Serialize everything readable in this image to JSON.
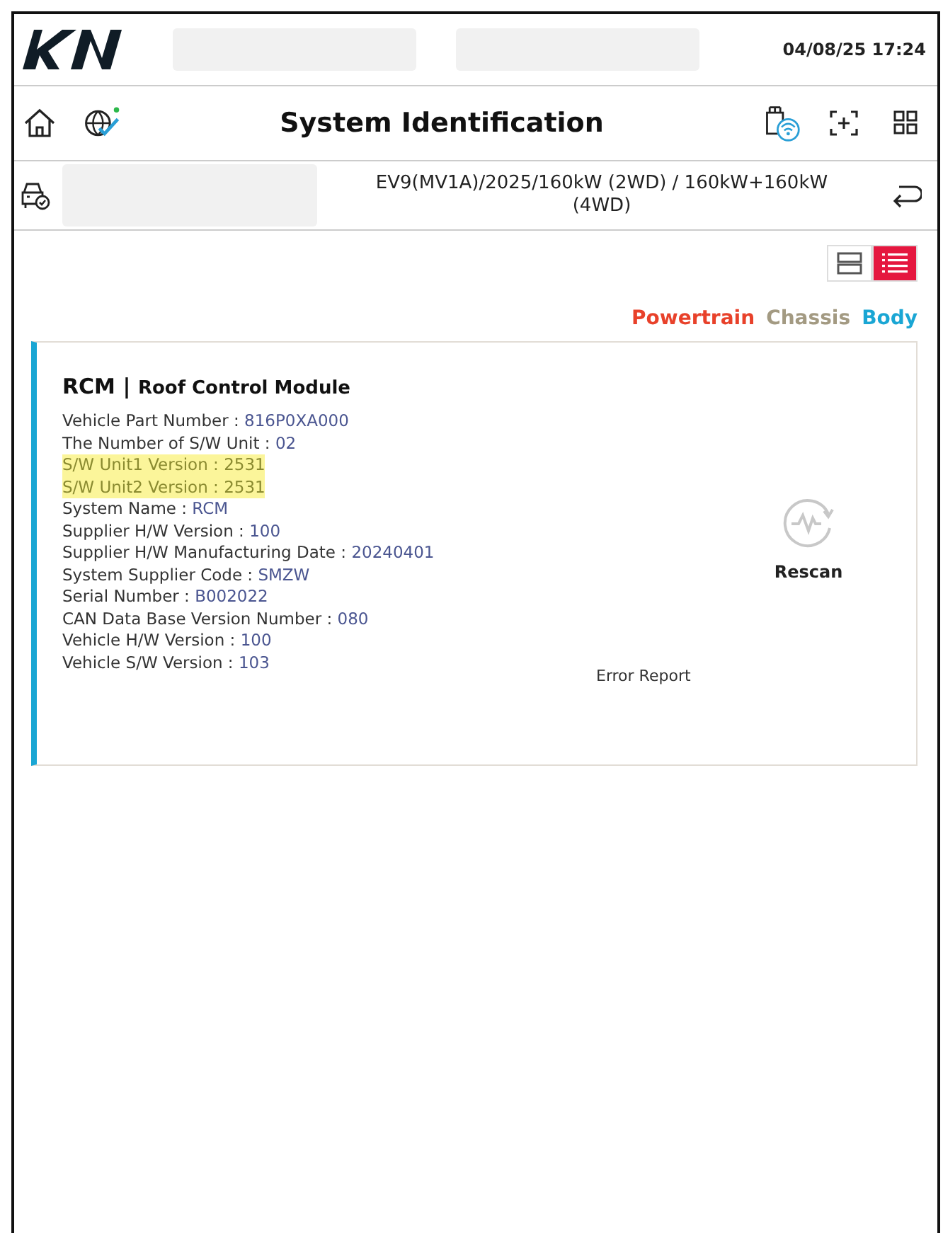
{
  "header": {
    "datetime": "04/08/25 17:24"
  },
  "nav": {
    "title": "System Identification"
  },
  "vehicle": {
    "description": "EV9(MV1A)/2025/160kW (2WD) / 160kW+160kW (4WD)"
  },
  "view_toggles": [
    {
      "kind": "cards",
      "selected": false
    },
    {
      "kind": "list",
      "selected": true
    }
  ],
  "categories": [
    {
      "label": "Powertrain",
      "color": "#e8412a"
    },
    {
      "label": "Chassis",
      "color": "#a39a82"
    },
    {
      "label": "Body",
      "color": "#1aa6d4"
    }
  ],
  "module": {
    "code": "RCM",
    "separator": "|",
    "name": "Roof Control Module",
    "color": "#1aa6d4",
    "fields": [
      {
        "label": "Vehicle Part Number : ",
        "value": "816P0XA000",
        "highlighted": false
      },
      {
        "label": "The Number of S/W Unit : ",
        "value": "02",
        "highlighted": false
      },
      {
        "label": "S/W Unit1 Version : ",
        "value": "2531",
        "highlighted": true
      },
      {
        "label": "S/W Unit2 Version : ",
        "value": "2531",
        "highlighted": true
      },
      {
        "label": "System Name : ",
        "value": "RCM",
        "highlighted": false
      },
      {
        "label": "Supplier H/W Version : ",
        "value": "100",
        "highlighted": false
      },
      {
        "label": "Supplier H/W Manufacturing Date : ",
        "value": "20240401",
        "highlighted": false
      },
      {
        "label": "System Supplier Code : ",
        "value": "SMZW",
        "highlighted": false
      },
      {
        "label": "Serial Number : ",
        "value": "B002022",
        "highlighted": false
      },
      {
        "label": "CAN Data Base Version Number : ",
        "value": "080",
        "highlighted": false
      },
      {
        "label": "Vehicle H/W Version : ",
        "value": "100",
        "highlighted": false
      },
      {
        "label": "Vehicle S/W Version : ",
        "value": "103",
        "highlighted": false
      }
    ],
    "rescan": "Rescan",
    "error_report": "Error Report"
  }
}
